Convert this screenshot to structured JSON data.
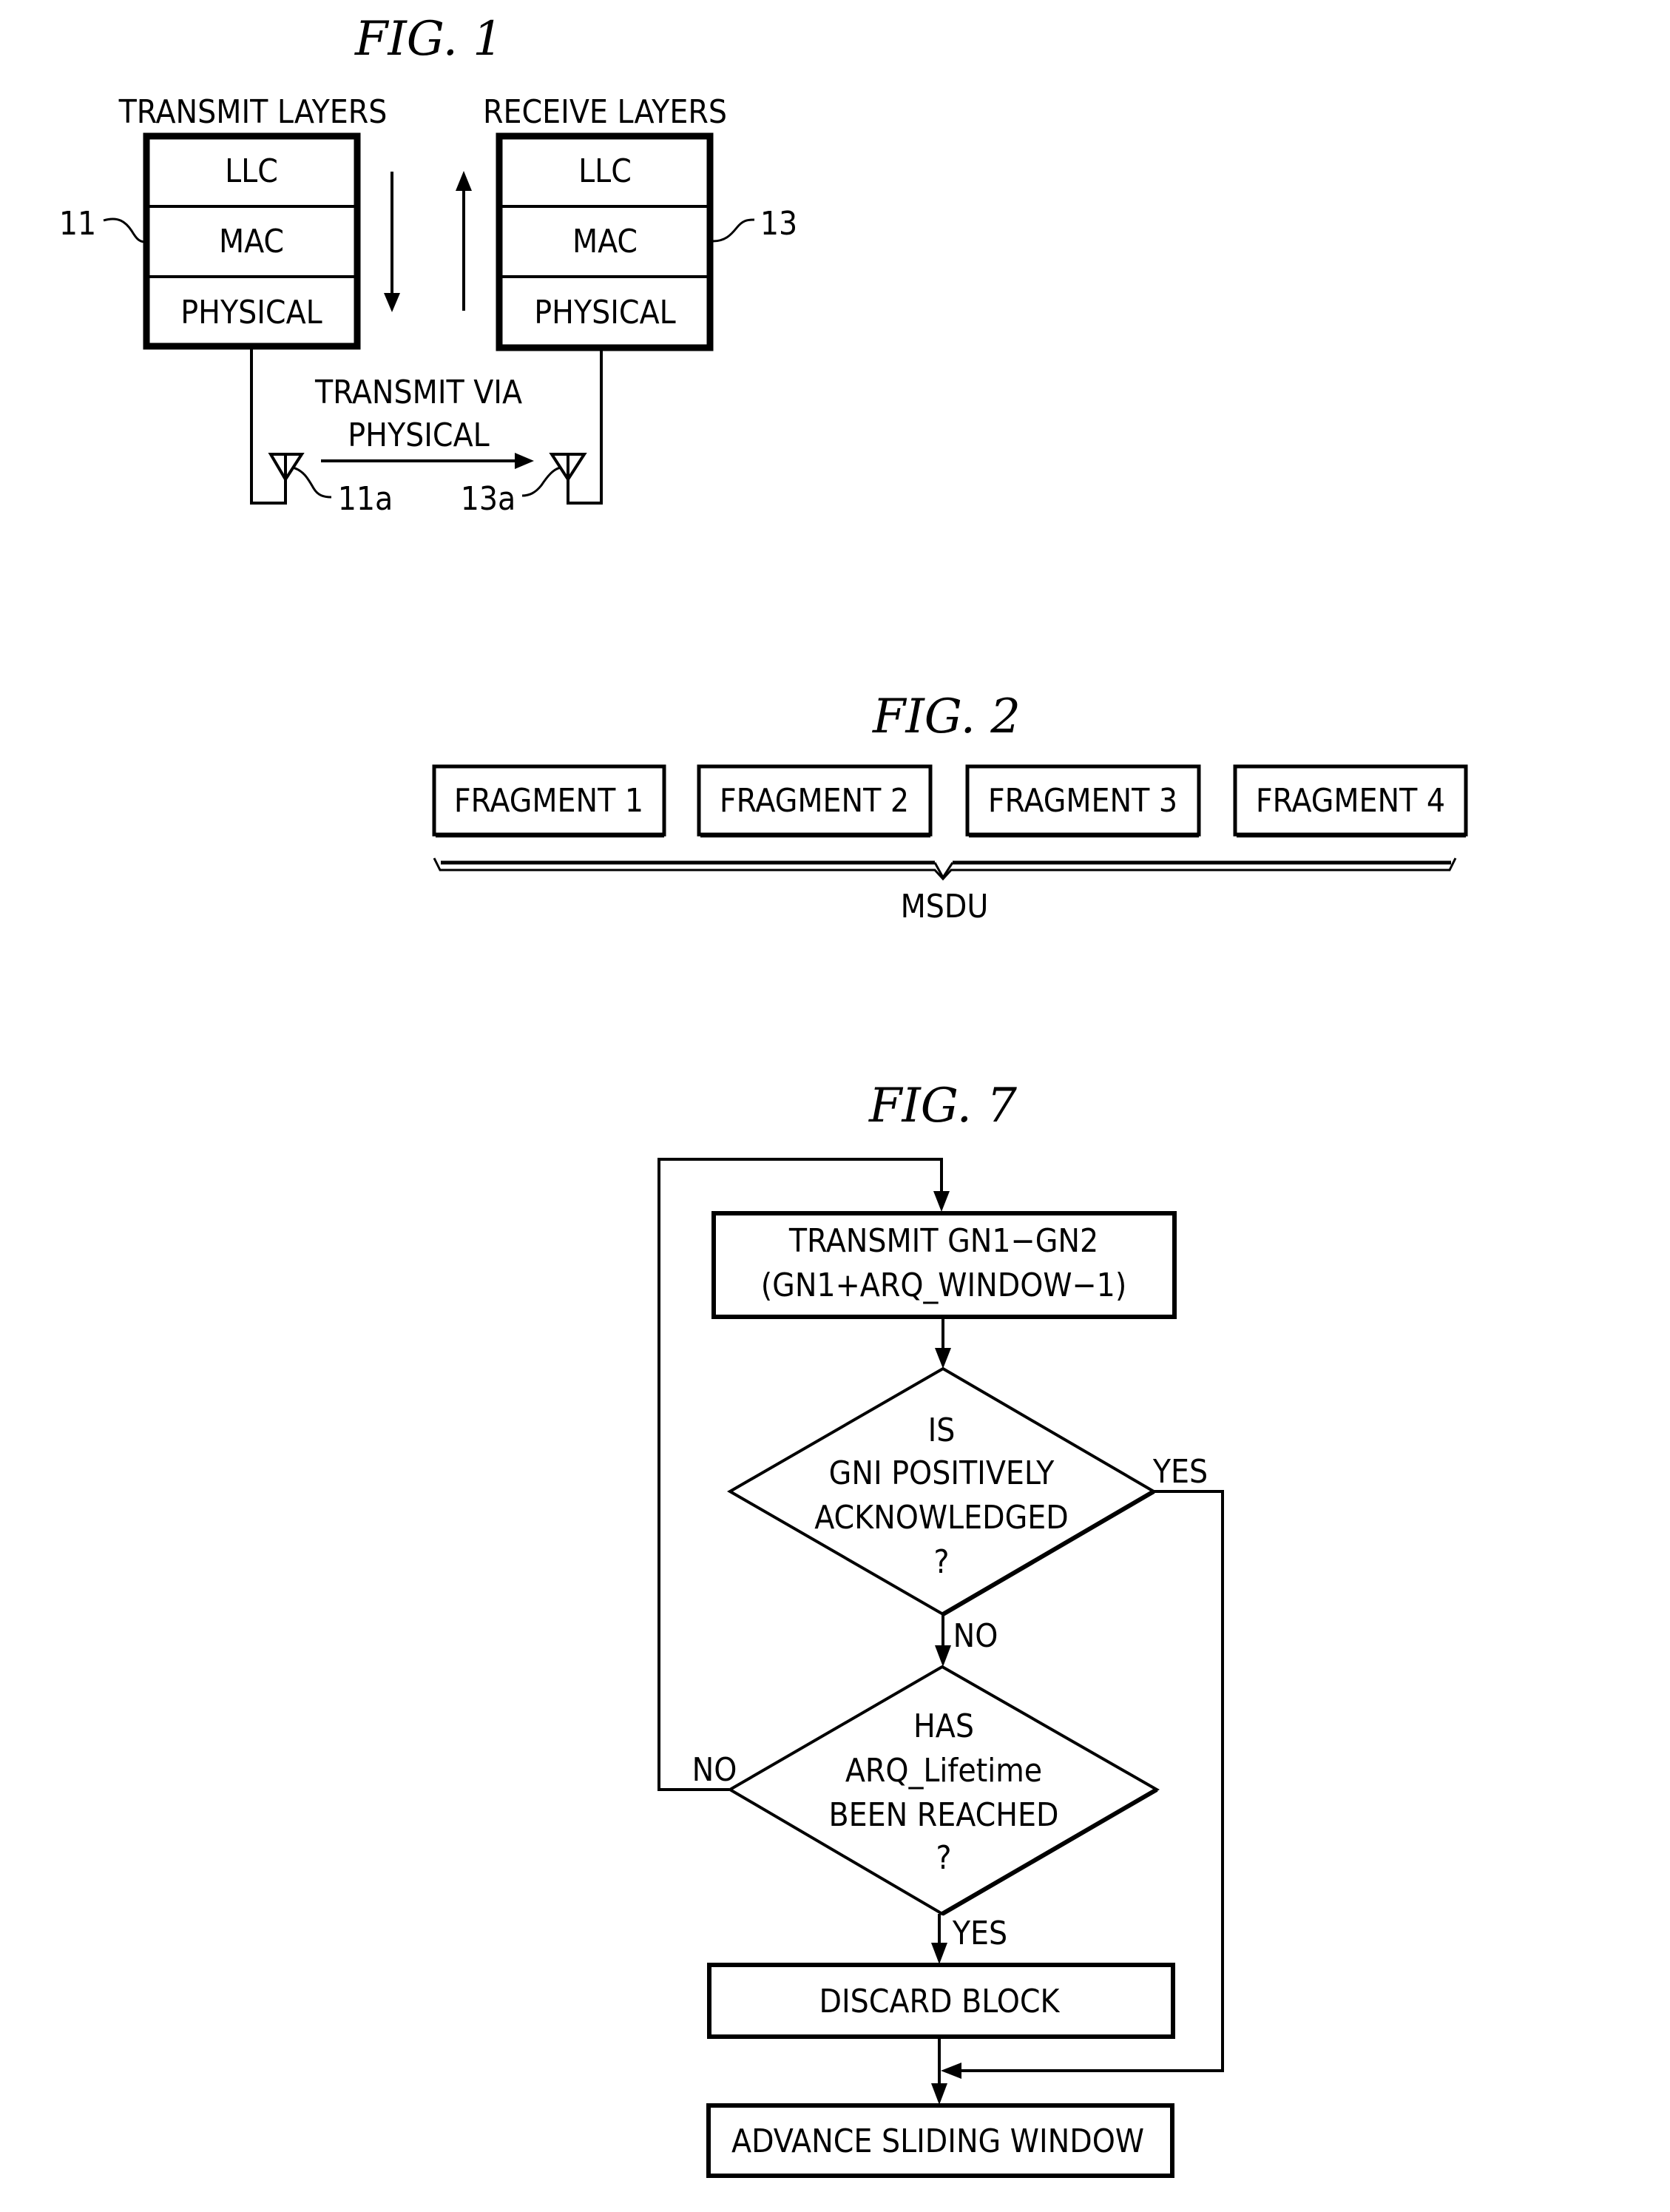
{
  "fig1": {
    "title": "FIG. 1",
    "transmit_heading": "TRANSMIT LAYERS",
    "receive_heading": "RECEIVE LAYERS",
    "transmit_stack": {
      "ref": "11",
      "layers": [
        "LLC",
        "MAC",
        "PHYSICAL"
      ]
    },
    "receive_stack": {
      "ref": "13",
      "layers": [
        "LLC",
        "MAC",
        "PHYSICAL"
      ]
    },
    "transmit_label_line1": "TRANSMIT VIA",
    "transmit_label_line2": "PHYSICAL",
    "antenna_tx_ref": "11a",
    "antenna_rx_ref": "13a"
  },
  "fig2": {
    "title": "FIG. 2",
    "fragments": [
      "FRAGMENT 1",
      "FRAGMENT 2",
      "FRAGMENT 3",
      "FRAGMENT 4"
    ],
    "brace_label": "MSDU"
  },
  "fig7": {
    "title": "FIG. 7",
    "transmit_box": {
      "line1": "TRANSMIT GN1−GN2",
      "line2": "(GN1+ARQ_WINDOW−1)"
    },
    "decision1": {
      "lines": [
        "IS",
        "GNI POSITIVELY",
        "ACKNOWLEDGED",
        "?"
      ],
      "yes": "YES",
      "no": "NO"
    },
    "decision2": {
      "lines": [
        "HAS",
        "ARQ_Lifetime",
        "BEEN REACHED",
        "?"
      ],
      "yes": "YES",
      "no": "NO"
    },
    "discard_box": "DISCARD BLOCK",
    "advance_box": "ADVANCE SLIDING WINDOW"
  }
}
